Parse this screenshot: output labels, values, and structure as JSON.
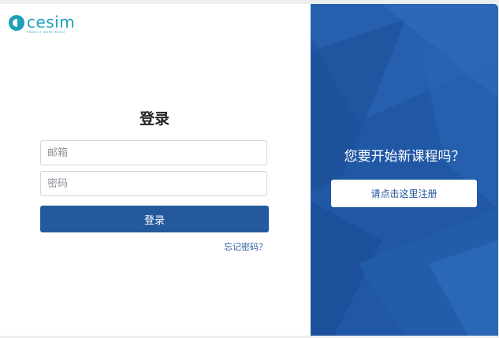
{
  "brand": {
    "name": "cesim",
    "tagline": "PREDICT MORE RIGHT",
    "color": "#1da0b8"
  },
  "login": {
    "title": "登录",
    "email_placeholder": "邮箱",
    "password_placeholder": "密码",
    "submit_label": "登录",
    "forgot_label": "忘记密码？",
    "button_color": "#245a9d"
  },
  "signup": {
    "heading": "您要开始新课程吗？",
    "button_label": "请点击这里注册",
    "panel_color": "#2158a6"
  }
}
